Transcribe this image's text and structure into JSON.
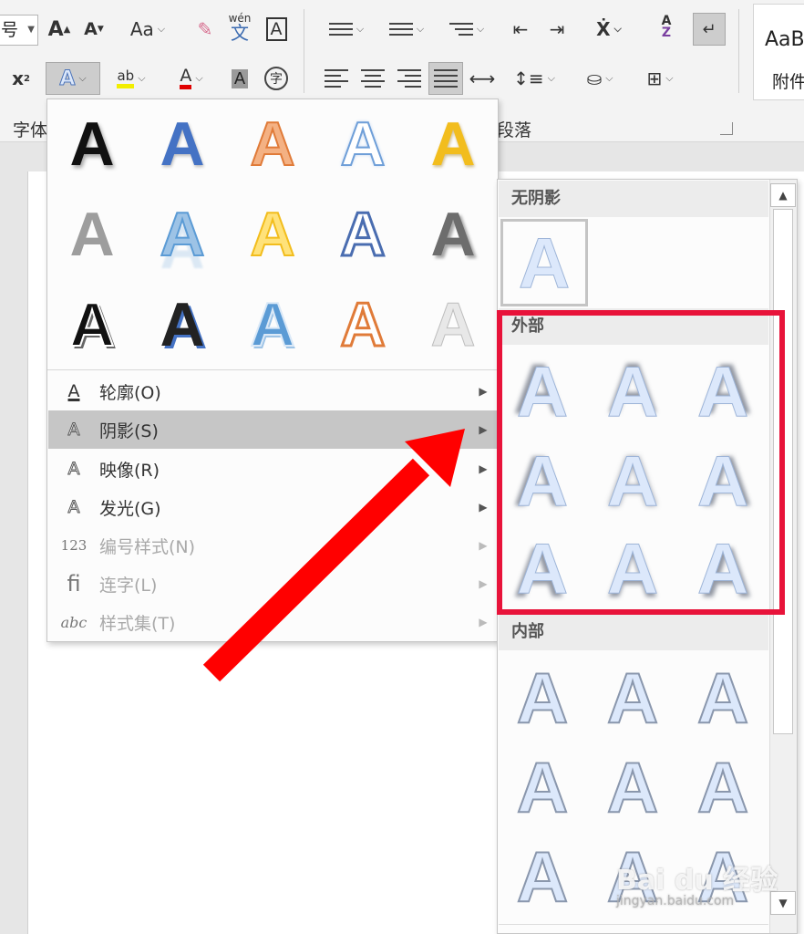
{
  "ribbon": {
    "font_size_value": "号",
    "buttons": {
      "grow_font": "A",
      "shrink_font": "A",
      "change_case": "Aa",
      "phonetic_top": "wén",
      "phonetic_bottom": "文",
      "char_border": "A",
      "superscript": "x",
      "superscript_mark": "2",
      "text_effects": "A",
      "highlight": "ab",
      "font_color": "A",
      "char_shading": "A",
      "enclose_char": "字",
      "sort_top": "A",
      "sort_bottom": "Z"
    },
    "group_font_label": "字体",
    "group_paragraph_label": "段落",
    "styles": {
      "sample": "AaB",
      "label": "附件"
    }
  },
  "effects_menu": {
    "gallery": [
      {
        "name": "fill-black-shadow",
        "glyph": "A"
      },
      {
        "name": "fill-blue-accent1",
        "glyph": "A"
      },
      {
        "name": "fill-orange-outline",
        "glyph": "A"
      },
      {
        "name": "outline-blue-white",
        "glyph": "A"
      },
      {
        "name": "fill-gold",
        "glyph": "A"
      },
      {
        "name": "gradient-gray",
        "glyph": "A"
      },
      {
        "name": "blue-reflection",
        "glyph": "A"
      },
      {
        "name": "gold-outline",
        "glyph": "A"
      },
      {
        "name": "blue-outline",
        "glyph": "A"
      },
      {
        "name": "dark-gray-shadow",
        "glyph": "A"
      },
      {
        "name": "black-outline-shadow",
        "glyph": "A"
      },
      {
        "name": "dark-blue-shadow",
        "glyph": "A"
      },
      {
        "name": "blue-outline-fill",
        "glyph": "A"
      },
      {
        "name": "orange-outline-white",
        "glyph": "A"
      },
      {
        "name": "light-gray-fill",
        "glyph": "A"
      }
    ],
    "items": [
      {
        "label": "轮廓(O)",
        "icon": "A",
        "state": "normal"
      },
      {
        "label": "阴影(S)",
        "icon": "A",
        "state": "hover"
      },
      {
        "label": "映像(R)",
        "icon": "A",
        "state": "normal"
      },
      {
        "label": "发光(G)",
        "icon": "A",
        "state": "normal"
      },
      {
        "label": "编号样式(N)",
        "icon": "123",
        "state": "disabled"
      },
      {
        "label": "连字(L)",
        "icon": "fi",
        "state": "disabled"
      },
      {
        "label": "样式集(T)",
        "icon": "abc",
        "state": "disabled"
      }
    ]
  },
  "shadow_menu": {
    "sections": [
      {
        "title": "无阴影"
      },
      {
        "title": "外部"
      },
      {
        "title": "内部"
      }
    ],
    "glyph": "A"
  },
  "watermark": {
    "brand": "Bai du 经验",
    "url": "jingyan.baidu.com"
  },
  "colors": {
    "highlight_box": "#e8133a",
    "arrow": "#ff0000",
    "menu_hover": "#c6c6c6"
  }
}
